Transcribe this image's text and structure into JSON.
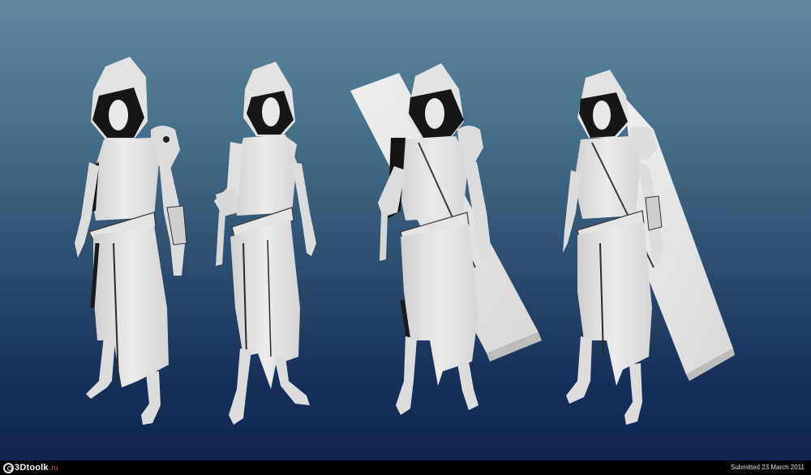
{
  "footer": {
    "brand": "3Dtoolk",
    "tld": ".ru",
    "submitted": "Submitted 23 March 2011"
  },
  "figures": [
    "hooded-figure-front",
    "hooded-figure-three-quarter",
    "hooded-figure-with-cloak",
    "hooded-figure-with-cloak-turned"
  ],
  "colors": {
    "model": "#e6e6e6",
    "shadow": "#141414",
    "bg_top": "#5f8a9c",
    "bg_bottom": "#102650"
  }
}
